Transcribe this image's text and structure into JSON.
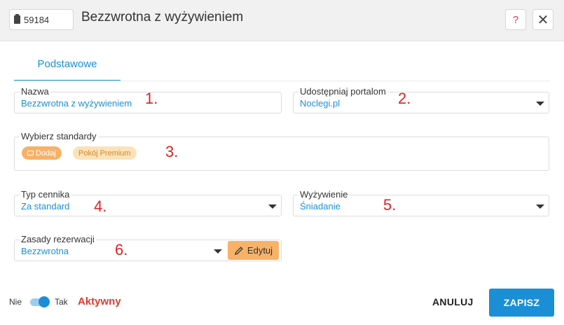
{
  "header": {
    "id": "59184",
    "title": "Bezzwrotna z wyżywieniem",
    "help": "?",
    "close": "✕"
  },
  "tabs": [
    {
      "label": "Podstawowe"
    }
  ],
  "form": {
    "name": {
      "label": "Nazwa",
      "value": "Bezzwrotna z wyżywieniem"
    },
    "portal": {
      "label": "Udostępniaj portalom",
      "value": "Noclegi.pl"
    },
    "standards": {
      "label": "Wybierz standardy",
      "add_label": "Dodaj",
      "chips": [
        "Pokój Premium"
      ]
    },
    "price_type": {
      "label": "Typ cennika",
      "value": "Za standard"
    },
    "meals": {
      "label": "Wyżywienie",
      "value": "Śniadanie"
    },
    "rules": {
      "label": "Zasady rezerwacji",
      "value": "Bezzwrotna",
      "edit_label": "Edytuj"
    }
  },
  "annotations": [
    "1.",
    "2.",
    "3.",
    "4.",
    "5.",
    "6."
  ],
  "footer": {
    "toggle_off": "Nie",
    "toggle_on": "Tak",
    "status": "Aktywny",
    "cancel": "ANULUJ",
    "save": "ZAPISZ"
  },
  "colors": {
    "accent": "#1a8fd6",
    "warning": "#f7b267",
    "annotation": "#e02020",
    "status": "#e03a2e"
  },
  "icons": [
    "clipboard-icon",
    "tag-icon",
    "pencil-icon",
    "help-icon",
    "close-icon",
    "chevron-down-icon"
  ]
}
